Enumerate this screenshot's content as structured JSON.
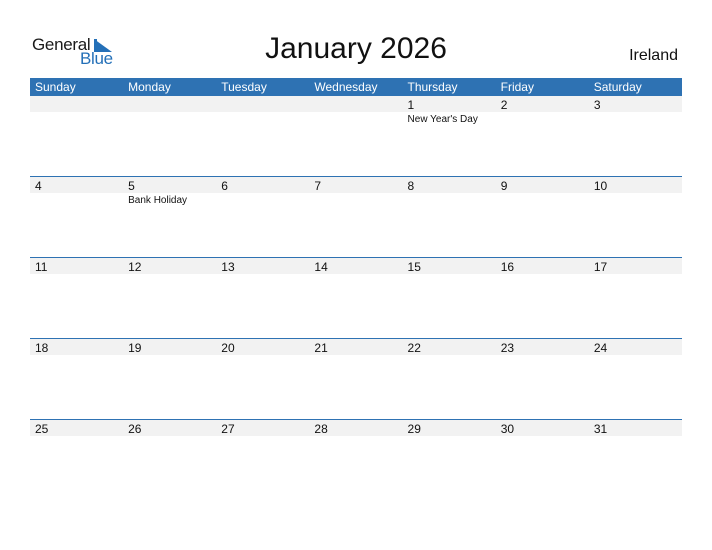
{
  "logo": {
    "text_general": "General",
    "text_blue": "Blue"
  },
  "title": "January 2026",
  "country": "Ireland",
  "colors": {
    "header_bg": "#2e72b3",
    "logo_blue": "#2470b8",
    "day_band": "#f2f2f2"
  },
  "weekdays": [
    "Sunday",
    "Monday",
    "Tuesday",
    "Wednesday",
    "Thursday",
    "Friday",
    "Saturday"
  ],
  "weeks": [
    [
      {
        "day": ""
      },
      {
        "day": ""
      },
      {
        "day": ""
      },
      {
        "day": ""
      },
      {
        "day": "1",
        "holiday": "New Year's Day"
      },
      {
        "day": "2"
      },
      {
        "day": "3"
      }
    ],
    [
      {
        "day": "4"
      },
      {
        "day": "5",
        "holiday": "Bank Holiday"
      },
      {
        "day": "6"
      },
      {
        "day": "7"
      },
      {
        "day": "8"
      },
      {
        "day": "9"
      },
      {
        "day": "10"
      }
    ],
    [
      {
        "day": "11"
      },
      {
        "day": "12"
      },
      {
        "day": "13"
      },
      {
        "day": "14"
      },
      {
        "day": "15"
      },
      {
        "day": "16"
      },
      {
        "day": "17"
      }
    ],
    [
      {
        "day": "18"
      },
      {
        "day": "19"
      },
      {
        "day": "20"
      },
      {
        "day": "21"
      },
      {
        "day": "22"
      },
      {
        "day": "23"
      },
      {
        "day": "24"
      }
    ],
    [
      {
        "day": "25"
      },
      {
        "day": "26"
      },
      {
        "day": "27"
      },
      {
        "day": "28"
      },
      {
        "day": "29"
      },
      {
        "day": "30"
      },
      {
        "day": "31"
      }
    ]
  ]
}
